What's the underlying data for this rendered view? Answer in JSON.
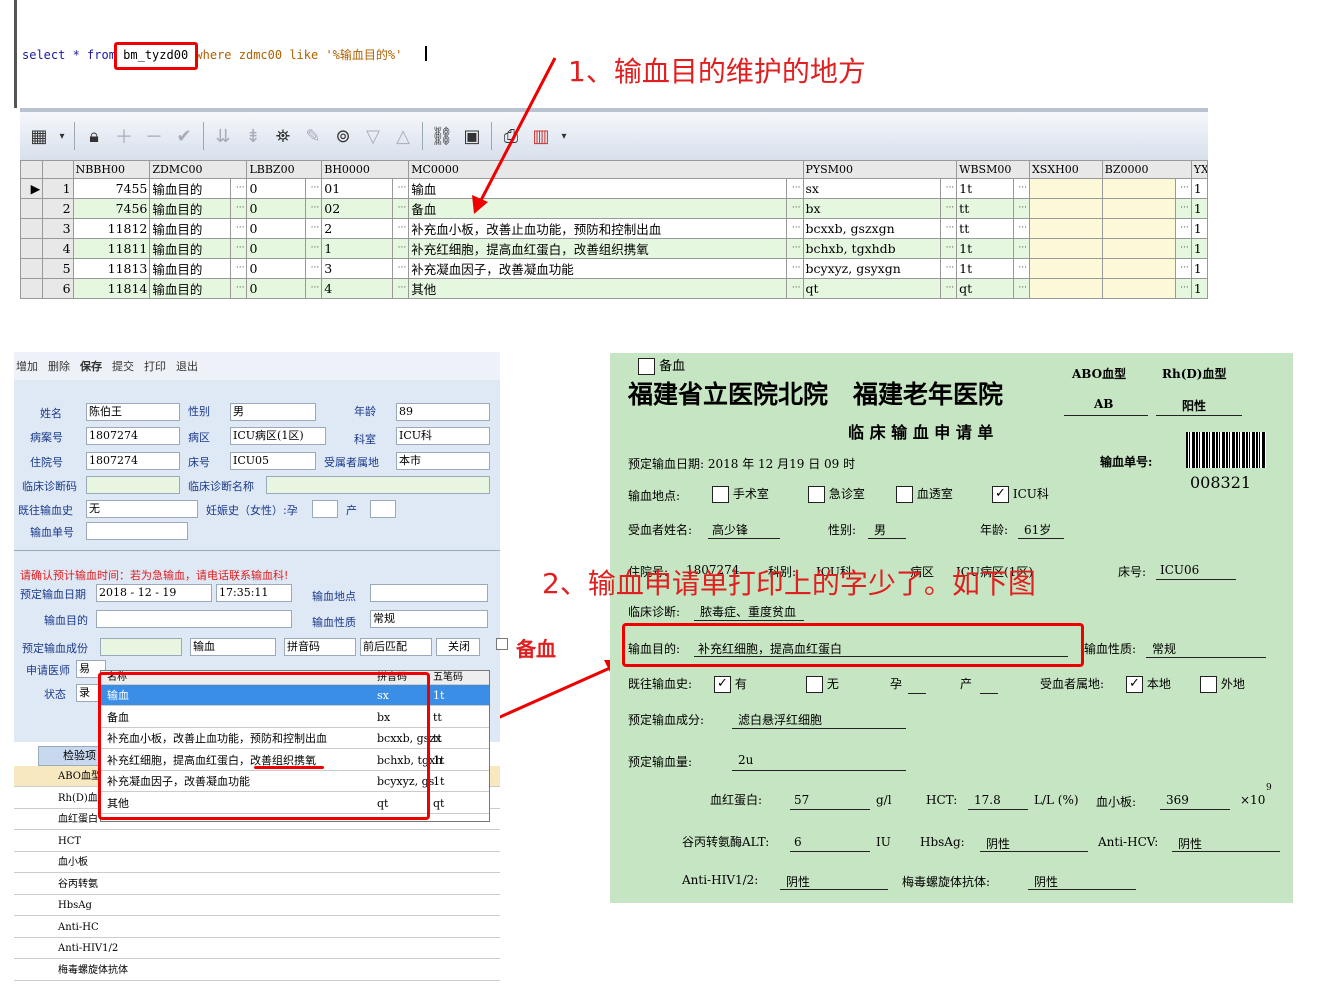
{
  "sql": {
    "prefix": "select * from ",
    "table": "bm_tyzd00",
    "suffix": " where zdmc00 like '%输血目的%'"
  },
  "annotations": {
    "a1": "1、输血目的维护的地方",
    "a2": "2、输血申请单打印上的字少了。如下图"
  },
  "grid": {
    "headers": [
      "NBBH00",
      "ZDMC00",
      "LBBZ00",
      "BH0000",
      "MC0000",
      "PYSM00",
      "WBSM00",
      "XSXH00",
      "BZ0000",
      "YX"
    ],
    "rows": [
      {
        "n": "1",
        "id": "7455",
        "zdmc": "输血目的",
        "lb": "0",
        "bh": "01",
        "mc": "输血",
        "py": "sx",
        "wb": "1t",
        "yx": "1"
      },
      {
        "n": "2",
        "id": "7456",
        "zdmc": "输血目的",
        "lb": "0",
        "bh": "02",
        "mc": "备血",
        "py": "bx",
        "wb": "tt",
        "yx": "1"
      },
      {
        "n": "3",
        "id": "11812",
        "zdmc": "输血目的",
        "lb": "0",
        "bh": "2",
        "mc": "补充血小板，改善止血功能，预防和控制出血",
        "py": "bcxxb, gszxgn",
        "wb": "tt",
        "yx": "1"
      },
      {
        "n": "4",
        "id": "11811",
        "zdmc": "输血目的",
        "lb": "0",
        "bh": "1",
        "mc": "补充红细胞，提高血红蛋白，改善组织携氧",
        "py": "bchxb, tgxhdb",
        "wb": "1t",
        "yx": "1"
      },
      {
        "n": "5",
        "id": "11813",
        "zdmc": "输血目的",
        "lb": "0",
        "bh": "3",
        "mc": "补充凝血因子，改善凝血功能",
        "py": "bcyxyz, gsyxgn",
        "wb": "1t",
        "yx": "1"
      },
      {
        "n": "6",
        "id": "11814",
        "zdmc": "输血目的",
        "lb": "0",
        "bh": "4",
        "mc": "其他",
        "py": "qt",
        "wb": "qt",
        "yx": "1"
      }
    ]
  },
  "form": {
    "toolbar": [
      "增加",
      "删除",
      "保存",
      "提交",
      "打印",
      "退出"
    ],
    "name_label": "姓名",
    "name": "陈伯王",
    "sex_label": "性别",
    "sex": "男",
    "age_label": "年龄",
    "age": "89",
    "case_label": "病案号",
    "case": "1807274",
    "ward_label": "病区",
    "ward": "ICU病区(1区)",
    "dept_label": "科室",
    "dept": "ICU科",
    "inp_label": "住院号",
    "inp": "1807274",
    "bed_label": "床号",
    "bed": "ICU05",
    "origin_label": "受属者属地",
    "origin": "本市",
    "diag_no_label": "临床诊断码",
    "diag_name_label": "临床诊断名称",
    "history_label": "既往输血史",
    "history": "无",
    "preg_label": "妊娠史（女性）:孕",
    "birth_label": "产",
    "order_label": "输血单号",
    "warning": "请确认预计输血时间：若为急输血，请电话联系输血科!",
    "date_label": "预定输血日期",
    "date": "2018 - 12 - 19",
    "time": "17:35:11",
    "place_label": "输血地点",
    "purpose_label": "输血目的",
    "nature_label": "输血性质",
    "nature": "常规",
    "component_label": "预定输血成份",
    "component_input": "输血",
    "py_select": "拼音码",
    "match_select": "前后匹配",
    "close": "关闭",
    "backup_label": "备血",
    "doctor_label": "申请医师",
    "doctor": "易",
    "status_label": "状态",
    "status": "录",
    "dropdown_head": [
      "名称",
      "拼音码",
      "五笔码"
    ],
    "dropdown": [
      {
        "name": "输血",
        "py": "sx",
        "wb": "1t"
      },
      {
        "name": "备血",
        "py": "bx",
        "wb": "tt"
      },
      {
        "name": "补充血小板，改善止血功能，预防和控制出血",
        "py": "bcxxb, gszx",
        "wb": "tt"
      },
      {
        "name": "补充红细胞，提高血红蛋白，改善组织携氧",
        "py": "bchxb, tgxh",
        "wb": "1t"
      },
      {
        "name": "补充凝血因子，改善凝血功能",
        "py": "bcyxyz, gs",
        "wb": "1t"
      },
      {
        "name": "其他",
        "py": "qt",
        "wb": "qt"
      }
    ],
    "sub_header": "检验项",
    "sub_rows": [
      "ABO血型",
      "Rh(D)血",
      "血红蛋白",
      "HCT",
      "血小板",
      "谷丙转氨",
      "HbsAg",
      "Anti-HC",
      "Anti-HIV1/2",
      "梅毒螺旋体抗体"
    ]
  },
  "print": {
    "backup": "备血",
    "hospital": "福建省立医院北院　福建老年医院",
    "abo_label": "ABO血型",
    "abo": "AB",
    "rh_label": "Rh(D)血型",
    "rh": "阳性",
    "title": "临 床 输 血 申 请 单",
    "order_label": "输血单号:",
    "order": "008321",
    "date_text": "预定输血日期: 2018 年 12 月19 日 09 时",
    "place_label": "输血地点:",
    "places": [
      "手术室",
      "急诊室",
      "血透室",
      "ICU科"
    ],
    "patient_label": "受血者姓名:",
    "patient": "高少锋",
    "sex_label": "性别:",
    "sex": "男",
    "age_label": "年龄:",
    "age": "61岁",
    "inp_label": "住院号:",
    "inp": "1807274",
    "dept_label": "科别:",
    "dept": "ICU科",
    "ward_label": "病区",
    "ward": "ICU病区(1区)",
    "bed_label": "床号:",
    "bed": "ICU06",
    "diag_label": "临床诊断:",
    "diag": "脓毒症、重度贫血",
    "purpose_label": "输血目的:",
    "purpose": "补充红细胞，提高血红蛋白",
    "nature_label": "输血性质:",
    "nature": "常规",
    "history_label": "既往输血史:",
    "yes": "有",
    "no": "无",
    "preg": "孕",
    "birth": "产",
    "origin_label": "受血者属地:",
    "local": "本地",
    "other": "外地",
    "component_label": "预定输血成分:",
    "component": "滤白悬浮红细胞",
    "amount_label": "预定输血量:",
    "amount": "2u",
    "hb_label": "血红蛋白:",
    "hb": "57",
    "hb_unit": "g/l",
    "hct_label": "HCT:",
    "hct": "17.8",
    "hct_unit": "L/L (%)",
    "plt_label": "血小板:",
    "plt": "369",
    "plt_unit": "×10",
    "alt_label": "谷丙转氨酶ALT:",
    "alt": "6",
    "alt_unit": "IU",
    "hbs_label": "HbsAg:",
    "hbs": "阴性",
    "hcv_label": "Anti-HCV:",
    "hcv": "阴性",
    "hiv_label": "Anti-HIV1/2:",
    "hiv": "阴性",
    "syph_label": "梅毒螺旋体抗体:",
    "syph": "阴性"
  },
  "colors": {
    "annotation": "#e02020",
    "print_bg": "#c6e5c2",
    "form_bg": "#dfe8f5"
  }
}
